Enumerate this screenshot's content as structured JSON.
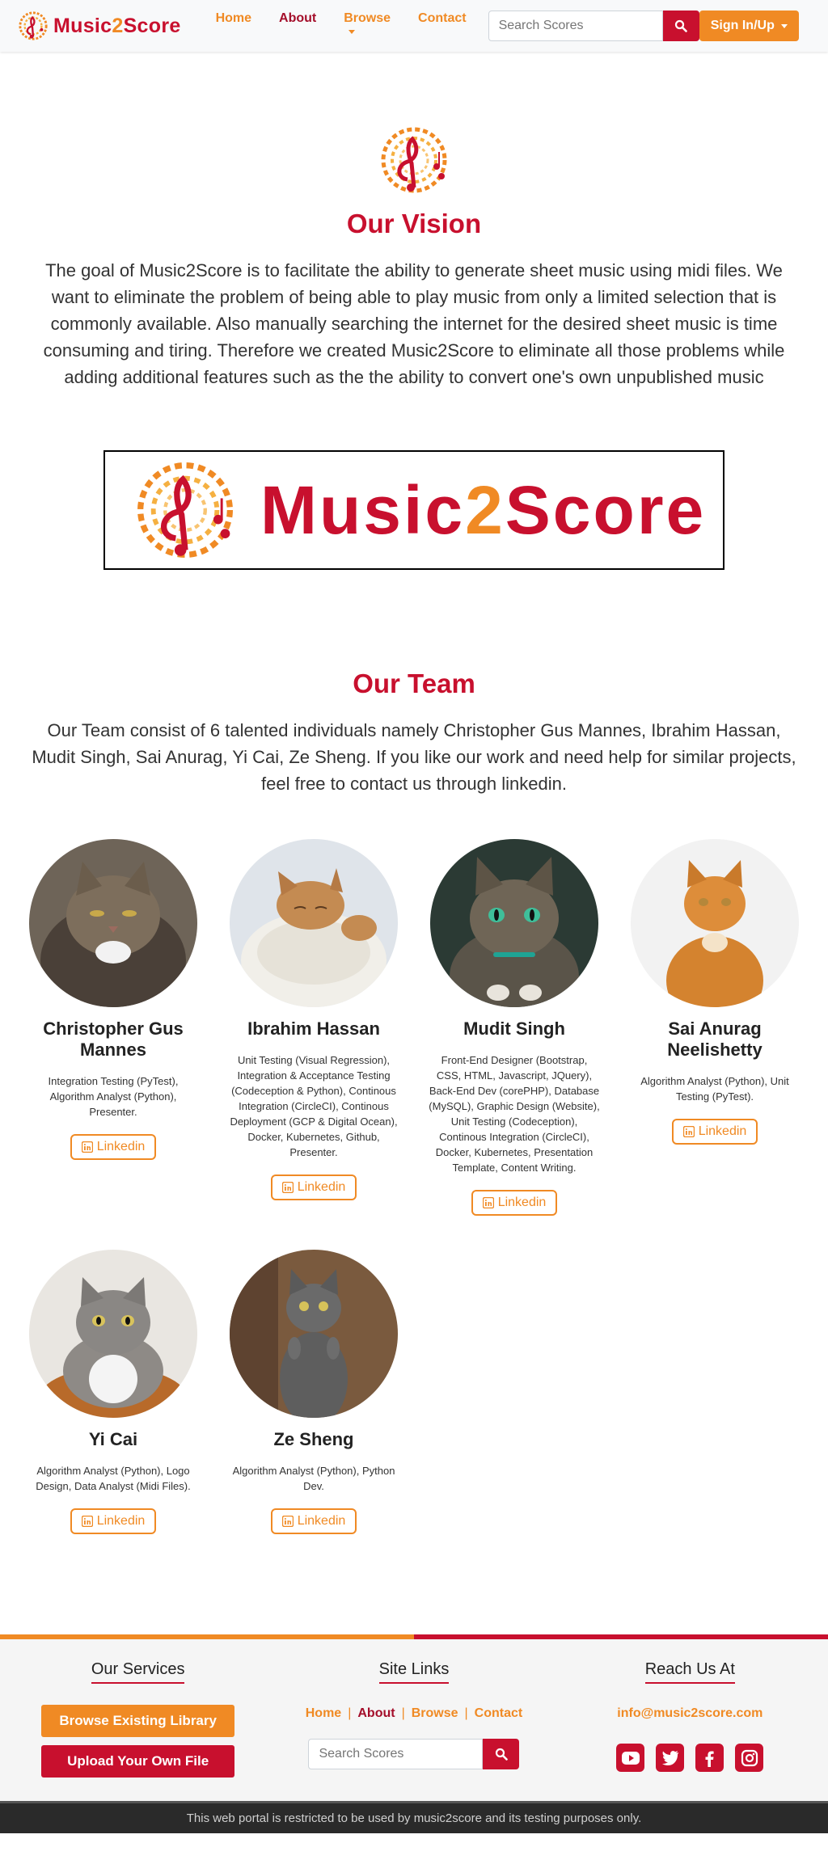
{
  "nav": {
    "brand_name_part1": "Music",
    "brand_name_part2": "2",
    "brand_name_part3": "Score",
    "links": [
      {
        "label": "Home"
      },
      {
        "label": "About"
      },
      {
        "label": "Browse"
      },
      {
        "label": "Contact"
      }
    ],
    "active_link": "About",
    "search_placeholder": "Search Scores",
    "signin_label": "Sign In/Up"
  },
  "vision": {
    "title": "Our Vision",
    "text": "The goal of Music2Score is to facilitate the ability to generate sheet music using midi files. We want to eliminate the problem of being able to play music from only a limited selection that is commonly available. Also manually searching the internet for the desired sheet music is time consuming and tiring. Therefore we created Music2Score to eliminate all those problems while adding additional features such as the the ability to convert one's own unpublished music"
  },
  "banner": {
    "text_part1": "Music",
    "text_part2": "2",
    "text_part3": "Score"
  },
  "team": {
    "title": "Our Team",
    "text": "Our Team consist of 6 talented individuals namely Christopher Gus Mannes, Ibrahim Hassan, Mudit Singh, Sai Anurag, Yi Cai, Ze Sheng. If you like our work and need help for similar projects, feel free to contact us through linkedin.",
    "members": [
      {
        "name": "Christopher Gus Mannes",
        "role": "Integration Testing (PyTest), Algorithm Analyst (Python), Presenter.",
        "button": "Linkedin"
      },
      {
        "name": "Ibrahim Hassan",
        "role": "Unit Testing (Visual Regression), Integration & Acceptance Testing (Codeception & Python), Continous Integration (CircleCI), Continous Deployment (GCP & Digital Ocean), Docker, Kubernetes, Github, Presenter.",
        "button": "Linkedin"
      },
      {
        "name": "Mudit Singh",
        "role": "Front-End Designer (Bootstrap, CSS, HTML, Javascript, JQuery), Back-End Dev (corePHP), Database (MySQL), Graphic Design (Website), Unit Testing (Codeception), Continous Integration (CircleCI), Docker, Kubernetes, Presentation Template, Content Writing.",
        "button": "Linkedin"
      },
      {
        "name": "Sai Anurag Neelishetty",
        "role": "Algorithm Analyst (Python), Unit Testing (PyTest).",
        "button": "Linkedin"
      },
      {
        "name": "Yi Cai",
        "role": "Algorithm Analyst (Python), Logo Design, Data Analyst (Midi Files).",
        "button": "Linkedin"
      },
      {
        "name": "Ze Sheng",
        "role": "Algorithm Analyst (Python), Python Dev.",
        "button": "Linkedin"
      }
    ]
  },
  "footer": {
    "services_title": "Our Services",
    "browse_button": "Browse Existing Library",
    "upload_button": "Upload Your Own File",
    "links_title": "Site Links",
    "links": [
      "Home",
      "About",
      "Browse",
      "Contact"
    ],
    "link_separator": "|",
    "search_placeholder": "Search Scores",
    "reach_title": "Reach Us At",
    "email": "info@music2score.com",
    "socials": [
      "youtube-icon",
      "twitter-icon",
      "facebook-icon",
      "instagram-icon"
    ],
    "disclaimer": "This web portal is restricted to be used by music2score and its testing purposes only."
  },
  "colors": {
    "brand_red": "#c8102e",
    "brand_orange": "#f08a24",
    "active_link": "#a40e2a"
  }
}
